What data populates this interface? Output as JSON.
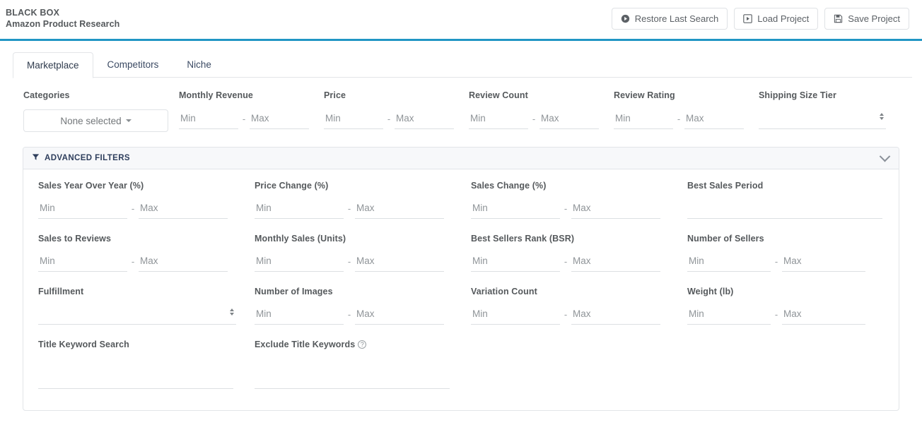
{
  "header": {
    "brand_line1": "BLACK BOX",
    "brand_line2": "Amazon Product Research",
    "accent_color": "#2196c4",
    "actions": [
      {
        "label": "Restore Last Search",
        "icon": "play-circle-icon"
      },
      {
        "label": "Load Project",
        "icon": "play-square-icon"
      },
      {
        "label": "Save Project",
        "icon": "floppy-disk-icon"
      }
    ]
  },
  "tabs": [
    {
      "label": "Marketplace",
      "active": true
    },
    {
      "label": "Competitors",
      "active": false
    },
    {
      "label": "Niche",
      "active": false
    }
  ],
  "primary_filters": {
    "categories": {
      "label": "Categories",
      "value": "None selected",
      "icon": "caret-down-icon"
    },
    "monthly_revenue": {
      "label": "Monthly Revenue",
      "min_placeholder": "Min",
      "max_placeholder": "Max",
      "min_value": "",
      "max_value": "",
      "separator": "-"
    },
    "price": {
      "label": "Price",
      "min_placeholder": "Min",
      "max_placeholder": "Max",
      "min_value": "",
      "max_value": "",
      "separator": "-"
    },
    "review_count": {
      "label": "Review Count",
      "min_placeholder": "Min",
      "max_placeholder": "Max",
      "min_value": "",
      "max_value": "",
      "separator": "-"
    },
    "review_rating": {
      "label": "Review Rating",
      "min_placeholder": "Min",
      "max_placeholder": "Max",
      "min_value": "",
      "max_value": "",
      "separator": "-"
    },
    "shipping_size_tier": {
      "label": "Shipping Size Tier",
      "value": "",
      "icon": "stepper-icon"
    }
  },
  "advanced_filters": {
    "title": "ADVANCED FILTERS",
    "filter_icon": "funnel-icon",
    "collapse_icon": "chevron-down-icon",
    "expanded": true,
    "fields": {
      "sales_yoy": {
        "label": "Sales Year Over Year (%)",
        "min_placeholder": "Min",
        "max_placeholder": "Max",
        "min_value": "",
        "max_value": "",
        "separator": "-"
      },
      "price_change": {
        "label": "Price Change (%)",
        "min_placeholder": "Min",
        "max_placeholder": "Max",
        "min_value": "",
        "max_value": "",
        "separator": "-"
      },
      "sales_change": {
        "label": "Sales Change (%)",
        "min_placeholder": "Min",
        "max_placeholder": "Max",
        "min_value": "",
        "max_value": "",
        "separator": "-"
      },
      "best_sales_period": {
        "label": "Best Sales Period",
        "placeholder": "",
        "value": ""
      },
      "sales_to_reviews": {
        "label": "Sales to Reviews",
        "min_placeholder": "Min",
        "max_placeholder": "Max",
        "min_value": "",
        "max_value": "",
        "separator": "-"
      },
      "monthly_sales": {
        "label": "Monthly Sales (Units)",
        "min_placeholder": "Min",
        "max_placeholder": "Max",
        "min_value": "",
        "max_value": "",
        "separator": "-"
      },
      "bsr": {
        "label": "Best Sellers Rank (BSR)",
        "min_placeholder": "Min",
        "max_placeholder": "Max",
        "min_value": "",
        "max_value": "",
        "separator": "-"
      },
      "number_of_sellers": {
        "label": "Number of Sellers",
        "min_placeholder": "Min",
        "max_placeholder": "Max",
        "min_value": "",
        "max_value": "",
        "separator": "-"
      },
      "fulfillment": {
        "label": "Fulfillment",
        "value": "",
        "icon": "stepper-icon"
      },
      "number_of_images": {
        "label": "Number of Images",
        "min_placeholder": "Min",
        "max_placeholder": "Max",
        "min_value": "",
        "max_value": "",
        "separator": "-"
      },
      "variation_count": {
        "label": "Variation Count",
        "min_placeholder": "Min",
        "max_placeholder": "Max",
        "min_value": "",
        "max_value": "",
        "separator": "-"
      },
      "weight": {
        "label": "Weight (lb)",
        "min_placeholder": "Min",
        "max_placeholder": "Max",
        "min_value": "",
        "max_value": "",
        "separator": "-"
      },
      "title_keyword_search": {
        "label": "Title Keyword Search",
        "placeholder": "",
        "value": ""
      },
      "exclude_title_keywords": {
        "label": "Exclude Title Keywords",
        "help_icon": "question-circle-icon",
        "help_glyph": "?",
        "placeholder": "",
        "value": ""
      }
    }
  }
}
